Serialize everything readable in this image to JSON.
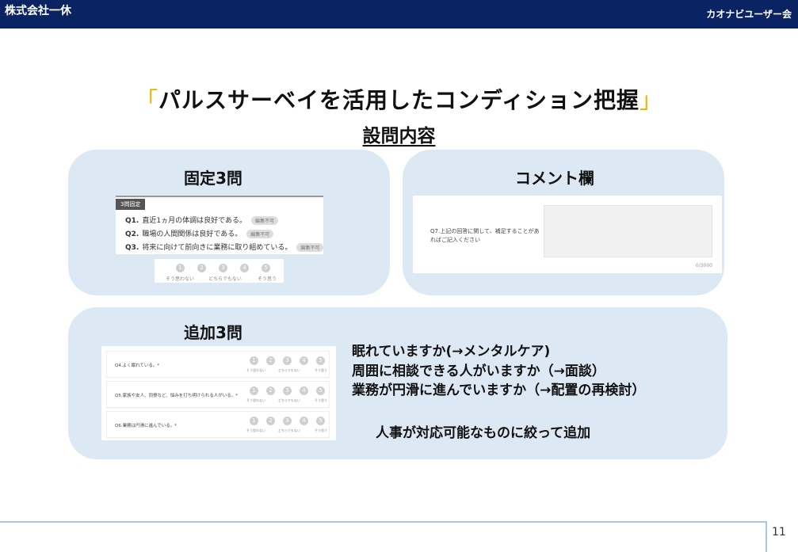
{
  "header": {
    "company": "株式会社一休",
    "group": "カオナビユーザー会"
  },
  "slide": {
    "title_open": "「",
    "title": "パルスサーベイを活用したコンディション把握",
    "title_close": "」",
    "subtitle": "設問内容",
    "page_number": "11"
  },
  "fixed": {
    "heading": "固定3問",
    "tag": "3問固定",
    "questions": [
      {
        "num": "Q1.",
        "text": "直近1ヵ月の体調は良好である。",
        "badge": "編集不可"
      },
      {
        "num": "Q2.",
        "text": "職場の人間関係は良好である。",
        "badge": "編集不可"
      },
      {
        "num": "Q3.",
        "text": "将来に向けて前向きに業務に取り組めている。",
        "badge": "編集不可"
      }
    ],
    "scale": [
      "1",
      "2",
      "3",
      "4",
      "5"
    ],
    "scale_labels": {
      "low": "そう思わない",
      "mid": "どちらでもない",
      "high": "そう思う"
    }
  },
  "comment": {
    "heading": "コメント欄",
    "question": "Q7.上記の回答に関して、補足することがあればご記入ください",
    "counter": "0/3000"
  },
  "added": {
    "heading": "追加3問",
    "questions": [
      {
        "text": "Q4.よく眠れている。*"
      },
      {
        "text": "Q5.家族や友人、同僚など、悩みを打ち明けられる人がいる。*"
      },
      {
        "text": "Q6.業務は円滑に進んでいる。*"
      }
    ],
    "scale": [
      "1",
      "2",
      "3",
      "4",
      "5"
    ],
    "scale_labels": {
      "low": "そう思わない",
      "mid": "どちらでもない",
      "high": "そう思う"
    },
    "notes": [
      "眠れていますか(→メンタルケア)",
      "周囲に相談できる人がいますか（→面談）",
      "業務が円滑に進んでいますか（→配置の再検討）"
    ],
    "summary": "人事が対応可能なものに絞って追加"
  }
}
